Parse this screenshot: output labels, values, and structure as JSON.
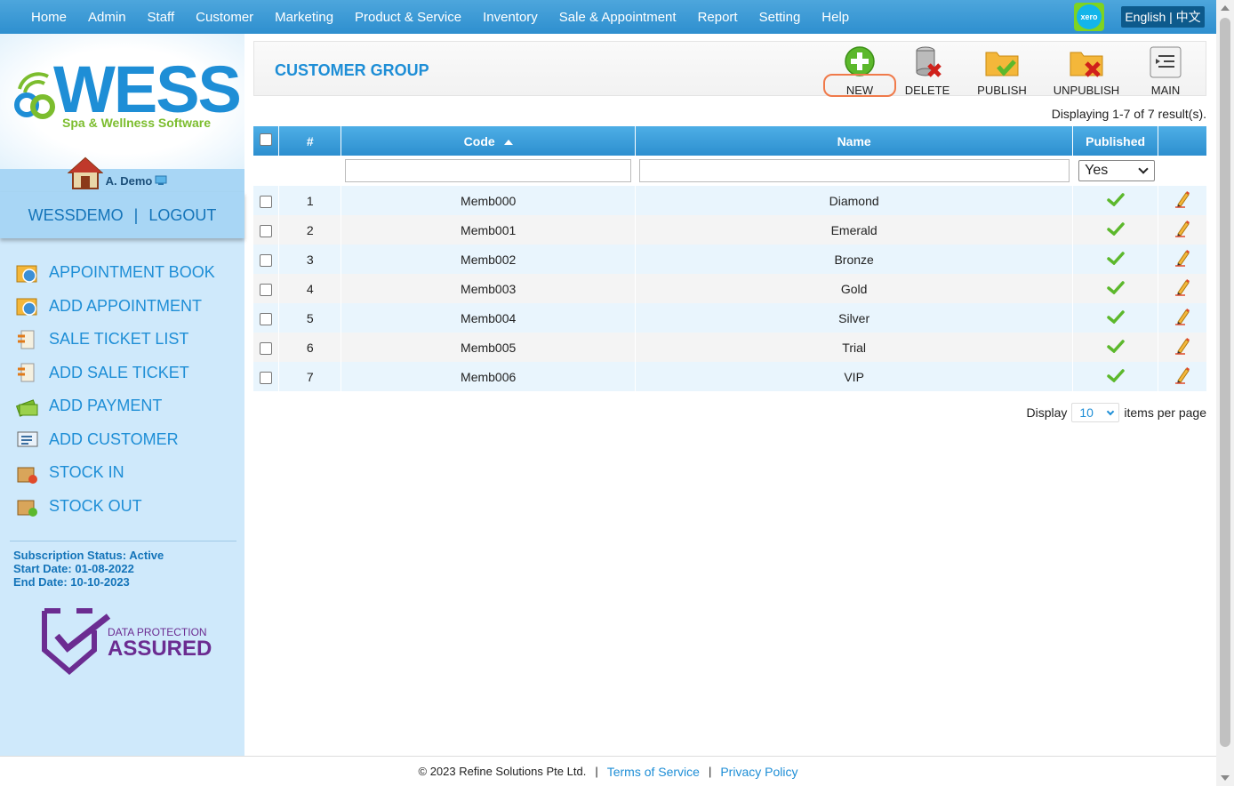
{
  "nav": {
    "items": [
      "Home",
      "Admin",
      "Staff",
      "Customer",
      "Marketing",
      "Product & Service",
      "Inventory",
      "Sale & Appointment",
      "Report",
      "Setting",
      "Help"
    ],
    "xero_label": "xero",
    "language": "English | 中文"
  },
  "sidebar": {
    "logo_text": "WESS",
    "logo_tagline": "Spa & Wellness Software",
    "user_name": "A. Demo",
    "account": "WESSDEMO",
    "separator": "|",
    "logout": "LOGOUT",
    "menu": [
      {
        "label": "APPOINTMENT BOOK",
        "icon": "calendar-clock-icon"
      },
      {
        "label": "ADD APPOINTMENT",
        "icon": "calendar-add-icon"
      },
      {
        "label": "SALE TICKET LIST",
        "icon": "ticket-list-icon"
      },
      {
        "label": "ADD SALE TICKET",
        "icon": "ticket-add-icon"
      },
      {
        "label": "ADD PAYMENT",
        "icon": "money-icon"
      },
      {
        "label": "ADD CUSTOMER",
        "icon": "customer-card-icon"
      },
      {
        "label": "STOCK IN",
        "icon": "box-in-icon"
      },
      {
        "label": "STOCK OUT",
        "icon": "box-out-icon"
      }
    ],
    "subscription": {
      "status": "Subscription Status: Active",
      "start": "Start Date: 01-08-2022",
      "end": "End Date: 10-10-2023"
    },
    "badge": {
      "line1": "DATA PROTECTION",
      "line2": "ASSURED"
    }
  },
  "page": {
    "title": "CUSTOMER GROUP",
    "toolbar": {
      "new": "NEW",
      "delete": "DELETE",
      "publish": "PUBLISH",
      "unpublish": "UNPUBLISH",
      "main": "MAIN"
    },
    "display_info": "Displaying 1-7 of 7 result(s).",
    "columns": {
      "num": "#",
      "code": "Code",
      "name": "Name",
      "published": "Published"
    },
    "filter": {
      "code": "",
      "name": "",
      "published": "Yes"
    },
    "rows": [
      {
        "num": "1",
        "code": "Memb000",
        "name": "Diamond",
        "published": true
      },
      {
        "num": "2",
        "code": "Memb001",
        "name": "Emerald",
        "published": true
      },
      {
        "num": "3",
        "code": "Memb002",
        "name": "Bronze",
        "published": true
      },
      {
        "num": "4",
        "code": "Memb003",
        "name": "Gold",
        "published": true
      },
      {
        "num": "5",
        "code": "Memb004",
        "name": "Silver",
        "published": true
      },
      {
        "num": "6",
        "code": "Memb005",
        "name": "Trial",
        "published": true
      },
      {
        "num": "7",
        "code": "Memb006",
        "name": "VIP",
        "published": true
      }
    ],
    "pager": {
      "display": "Display",
      "per_page": "10",
      "suffix": "items per page"
    }
  },
  "footer": {
    "copyright": "© 2023 Refine Solutions Pte Ltd.",
    "sep": "|",
    "terms": "Terms of Service",
    "privacy": "Privacy Policy"
  },
  "colors": {
    "accent": "#1e8ed6",
    "header": "#2e8fcf",
    "highlight": "#f07a4a"
  }
}
